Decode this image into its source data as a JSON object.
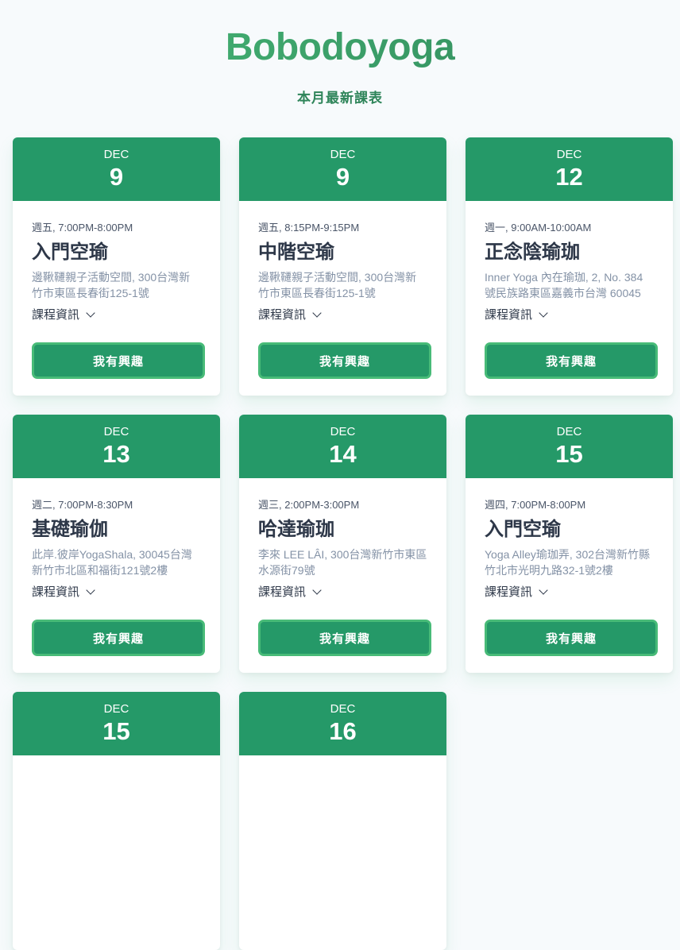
{
  "brand": "Bobodoyoga",
  "subtitle": "本月最新課表",
  "colors": {
    "accent": "#259968",
    "accent_light": "#48bb78",
    "brand_dark": "#2f855a"
  },
  "details_label": "課程資訊",
  "details_icon": "chevron-down-icon",
  "cta_label": "我有興趣",
  "classes": [
    {
      "month": "DEC",
      "day": "9",
      "time": "週五, 7:00PM-8:00PM",
      "name": "入門空瑜",
      "location": "邊鞦韆親子活動空間, 300台灣新竹市東區長春街125-1號"
    },
    {
      "month": "DEC",
      "day": "9",
      "time": "週五, 8:15PM-9:15PM",
      "name": "中階空瑜",
      "location": "邊鞦韆親子活動空間, 300台灣新竹市東區長春街125-1號"
    },
    {
      "month": "DEC",
      "day": "12",
      "time": "週一, 9:00AM-10:00AM",
      "name": "正念陰瑜珈",
      "location": "Inner Yoga 內在瑜珈, 2, No. 384號民族路東區嘉義市台灣 60045"
    },
    {
      "month": "DEC",
      "day": "13",
      "time": "週二, 7:00PM-8:30PM",
      "name": "基礎瑜伽",
      "location": "此岸.彼岸YogaShala, 30045台灣新竹市北區和福街121號2樓"
    },
    {
      "month": "DEC",
      "day": "14",
      "time": "週三, 2:00PM-3:00PM",
      "name": "哈達瑜珈",
      "location": "李來 LEE LÂI, 300台灣新竹市東區水源街79號"
    },
    {
      "month": "DEC",
      "day": "15",
      "time": "週四, 7:00PM-8:00PM",
      "name": "入門空瑜",
      "location": "Yoga Alley瑜珈弄, 302台灣新竹縣竹北市光明九路32-1號2樓"
    },
    {
      "month": "DEC",
      "day": "15",
      "time": "",
      "name": "",
      "location": ""
    },
    {
      "month": "DEC",
      "day": "16",
      "time": "",
      "name": "",
      "location": ""
    }
  ]
}
